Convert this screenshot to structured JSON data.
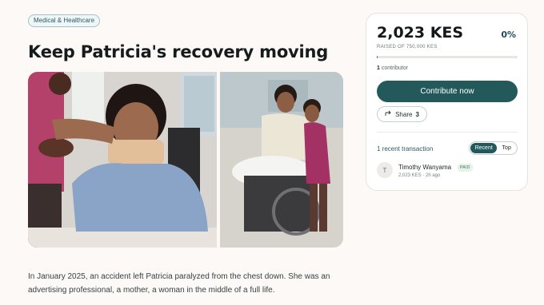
{
  "campaign": {
    "category": "Medical & Healthcare",
    "title": "Keep Patricia's recovery moving",
    "story": "In January 2025, an accident left Patricia paralyzed from the chest down. She was an advertising professional, a mother, a woman in the middle of a full life."
  },
  "funding": {
    "raised_label": "2,023 KES",
    "percent_label": "0%",
    "progress_fraction": 0.003,
    "goal_label": "RAISED OF 750,000 KES",
    "contributor_count": "1",
    "contributor_label": "contributor"
  },
  "actions": {
    "contribute_label": "Contribute now",
    "share_label": "Share",
    "share_count": "3"
  },
  "transactions": {
    "header": "1 recent transaction",
    "toggle_recent": "Recent",
    "toggle_top": "Top",
    "items": [
      {
        "avatar_letter": "T",
        "name": "Timothy Wanyama",
        "status": "PAID",
        "meta": "2,023 KES · 2h ago"
      }
    ]
  },
  "colors": {
    "accent": "#24595b",
    "page_bg": "#fcf9f7"
  },
  "icons": {
    "share": "share-arrow-icon"
  }
}
